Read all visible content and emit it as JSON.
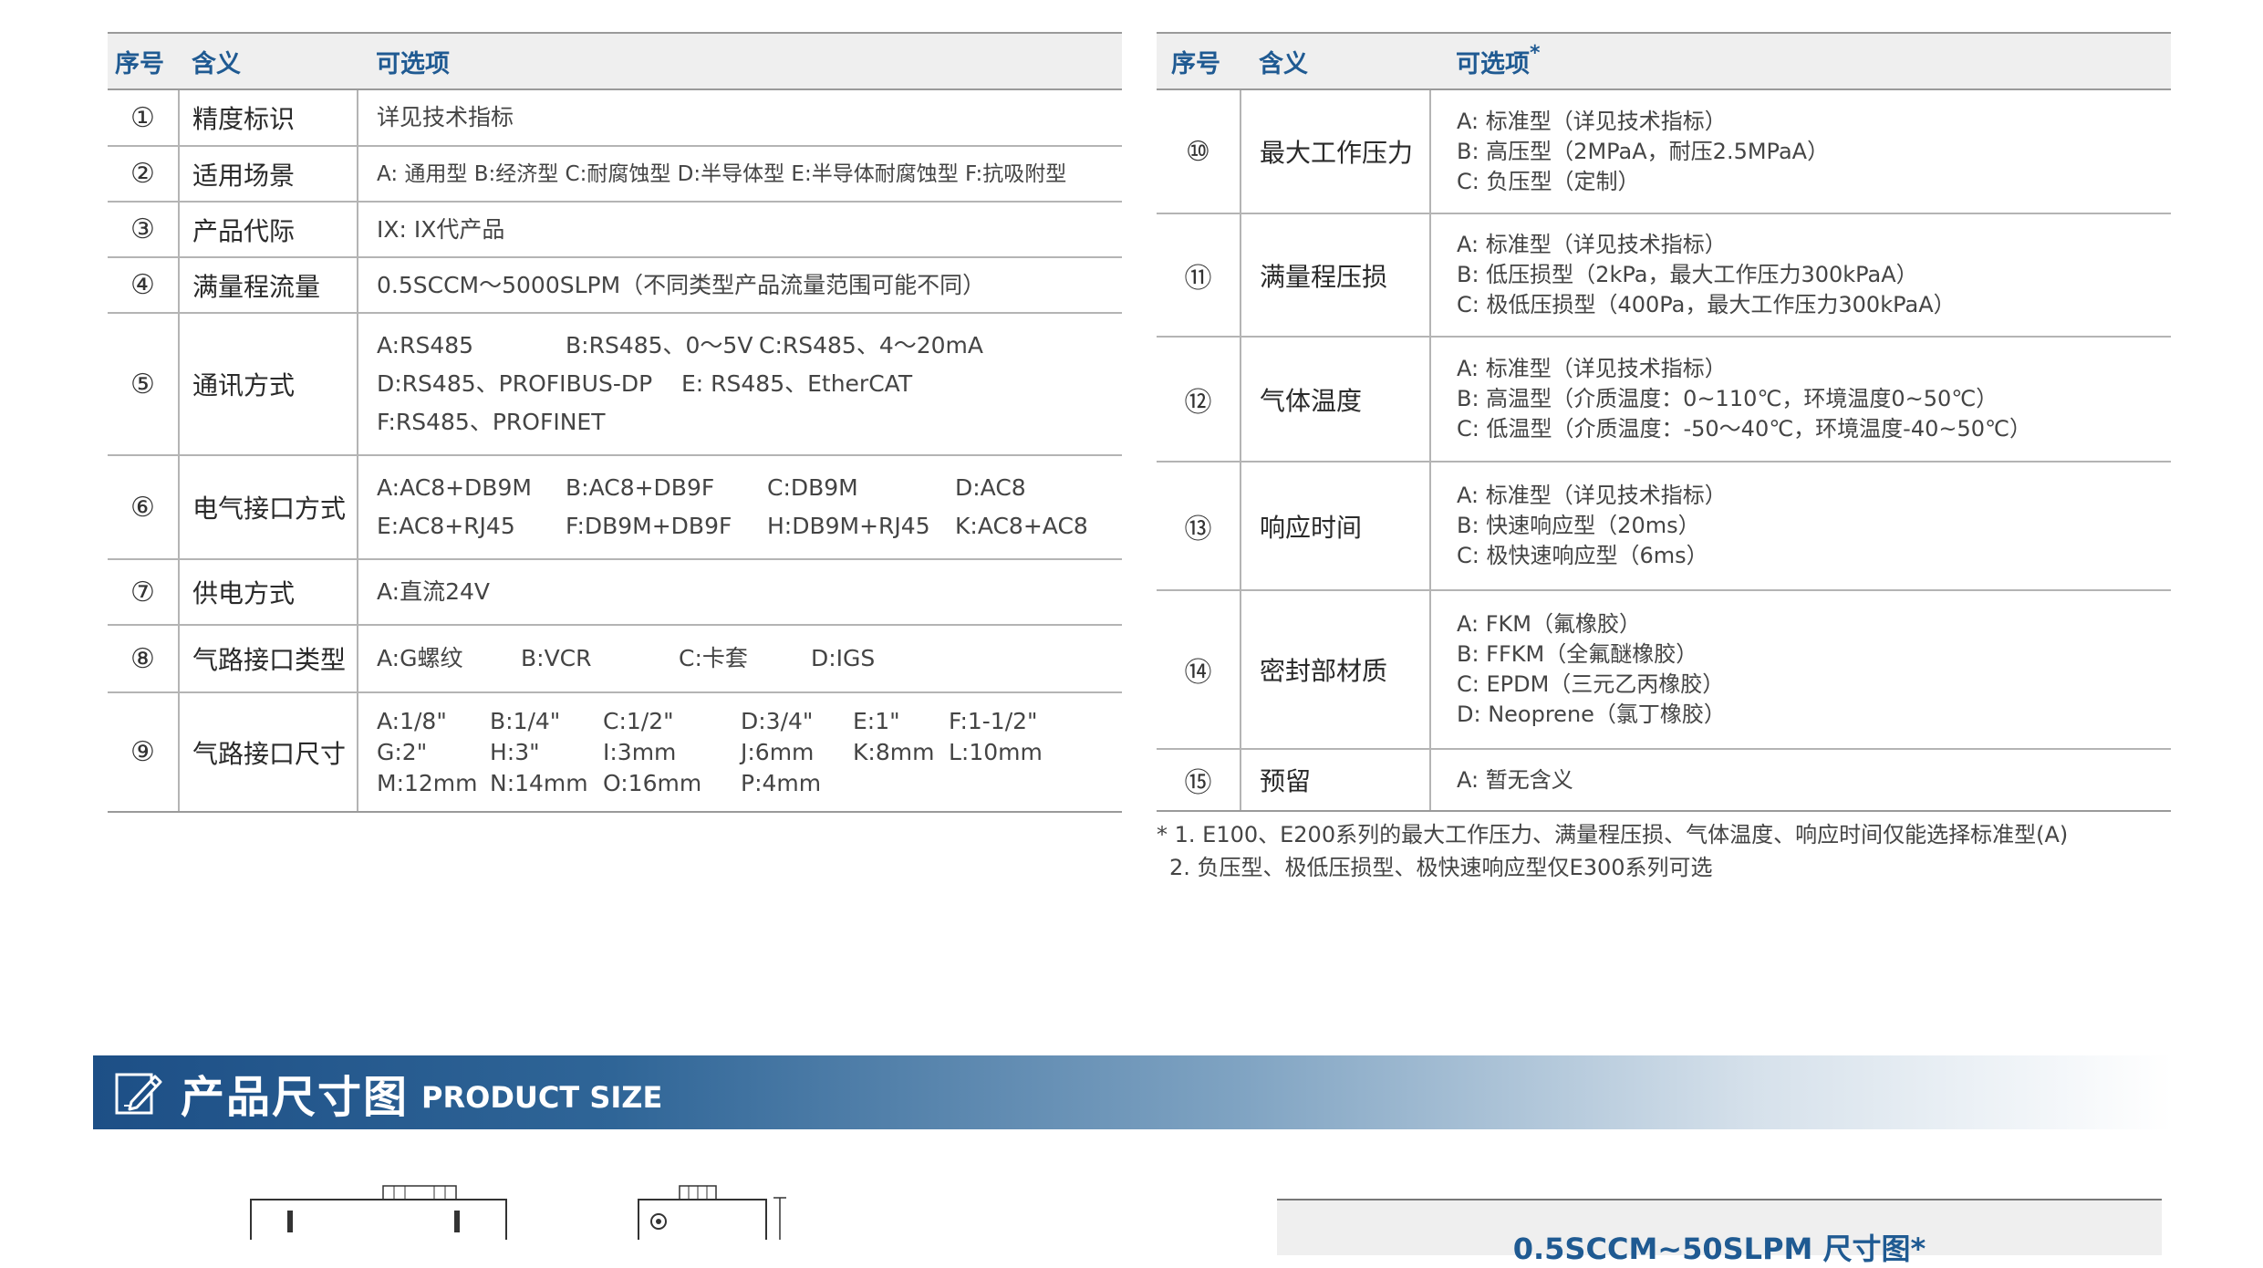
{
  "left_table": {
    "headers": [
      "序号",
      "含义",
      "可选项"
    ],
    "rows": [
      {
        "num": "①",
        "meaning": "精度标识",
        "options": [
          "详见技术指标"
        ]
      },
      {
        "num": "②",
        "meaning": "适用场景",
        "options": [
          "A: 通用型   B:经济型   C:耐腐蚀型   D:半导体型   E:半导体耐腐蚀型   F:抗吸附型"
        ]
      },
      {
        "num": "③",
        "meaning": "产品代际",
        "options": [
          "IX: IX代产品"
        ]
      },
      {
        "num": "④",
        "meaning": "满量程流量",
        "options": [
          "0.5SCCM～5000SLPM（不同类型产品流量范围可能不同）"
        ]
      },
      {
        "num": "⑤",
        "meaning": "通讯方式",
        "grid": [
          [
            "A:RS485",
            "B:RS485、0～5V",
            "C:RS485、4～20mA"
          ],
          [
            "D:RS485、PROFIBUS-DP",
            "E: RS485、EtherCAT"
          ],
          [
            "F:RS485、PROFINET"
          ]
        ]
      },
      {
        "num": "⑥",
        "meaning": "电气接口方式",
        "grid": [
          [
            "A:AC8+DB9M",
            "B:AC8+DB9F",
            "C:DB9M",
            "D:AC8"
          ],
          [
            "E:AC8+RJ45",
            "F:DB9M+DB9F",
            "H:DB9M+RJ45",
            "K:AC8+AC8"
          ]
        ]
      },
      {
        "num": "⑦",
        "meaning": "供电方式",
        "options": [
          "A:直流24V"
        ]
      },
      {
        "num": "⑧",
        "meaning": "气路接口类型",
        "grid": [
          [
            "A:G螺纹",
            "B:VCR",
            "C:卡套",
            "D:IGS"
          ]
        ]
      },
      {
        "num": "⑨",
        "meaning": "气路接口尺寸",
        "grid": [
          [
            "A:1/8\"",
            "B:1/4\"",
            "C:1/2\"",
            "D:3/4\"",
            "E:1\"",
            "F:1-1/2\""
          ],
          [
            "G:2\"",
            "H:3\"",
            "I:3mm",
            "J:6mm",
            "K:8mm",
            "L:10mm"
          ],
          [
            "M:12mm",
            "N:14mm",
            "O:16mm",
            "P:4mm"
          ]
        ]
      }
    ]
  },
  "right_table": {
    "headers": [
      "序号",
      "含义",
      "可选项"
    ],
    "header_star": "*",
    "rows": [
      {
        "num": "⑩",
        "meaning": "最大工作压力",
        "options": [
          "A: 标准型（详见技术指标）",
          "B: 高压型（2MPaA，耐压2.5MPaA）",
          "C: 负压型（定制）"
        ]
      },
      {
        "num": "⑪",
        "meaning": "满量程压损",
        "options": [
          "A: 标准型（详见技术指标）",
          "B: 低压损型（2kPa，最大工作压力300kPaA）",
          "C: 极低压损型（400Pa，最大工作压力300kPaA）"
        ]
      },
      {
        "num": "⑫",
        "meaning": "气体温度",
        "options": [
          "A: 标准型（详见技术指标）",
          "B: 高温型（介质温度：0~110℃，环境温度0~50℃）",
          "C: 低温型（介质温度：-50～40℃，环境温度-40~50℃）"
        ]
      },
      {
        "num": "⑬",
        "meaning": "响应时间",
        "options": [
          "A: 标准型（详见技术指标）",
          "B: 快速响应型（20ms）",
          "C: 极快速响应型（6ms）"
        ]
      },
      {
        "num": "⑭",
        "meaning": "密封部材质",
        "options": [
          "A: FKM（氟橡胶）",
          "B: FFKM（全氟醚橡胶）",
          "C: EPDM（三元乙丙橡胶）",
          "D: Neoprene（氯丁橡胶）"
        ]
      },
      {
        "num": "⑮",
        "meaning": "预留",
        "options": [
          "A: 暂无含义"
        ]
      }
    ]
  },
  "footnote": {
    "line1": "* 1. E100、E200系列的最大工作压力、满量程压损、气体温度、响应时间仅能选择标准型(A)",
    "line2": "  2. 负压型、极低压损型、极快速响应型仅E300系列可选"
  },
  "banner": {
    "title_cn": "产品尺寸图",
    "title_en": "PRODUCT SIZE",
    "icon": "edit-pencil-icon",
    "gradient_start": "#1d4f86"
  },
  "size_box": {
    "title": "0.5SCCM~50SLPM 尺寸图*"
  },
  "colors": {
    "header_text": "#1f5a92",
    "header_bg": "#efefef"
  }
}
